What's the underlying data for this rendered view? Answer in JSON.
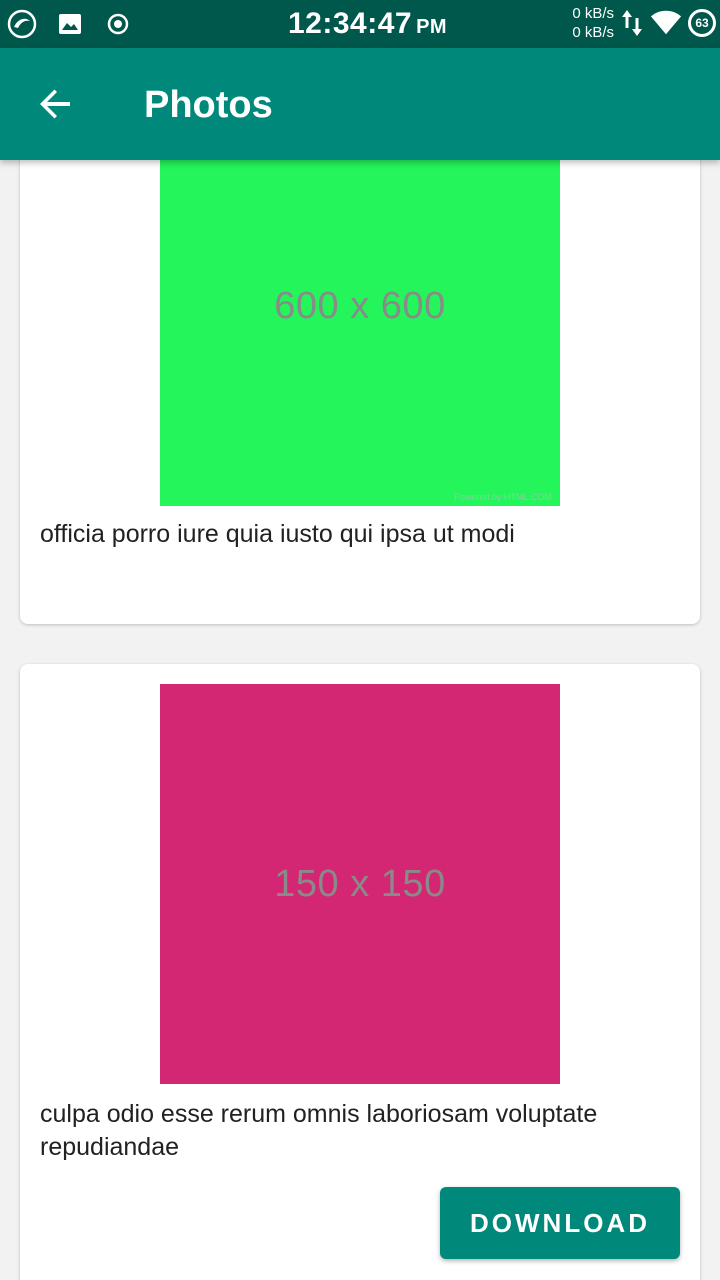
{
  "status_bar": {
    "time": "12:34:47",
    "ampm": "PM",
    "net_up": "0 kB/s",
    "net_down": "0 kB/s",
    "battery": "63",
    "icons": [
      "app-notification-icon",
      "image-icon",
      "record-icon",
      "data-transfer-icon",
      "wifi-icon",
      "battery-icon"
    ]
  },
  "app_bar": {
    "title": "Photos",
    "back_icon": "arrow-left-icon",
    "color": "#00897b"
  },
  "cards": [
    {
      "thumbnail_text": "600 x 600",
      "thumbnail_credit": "Powered by HTML.COM",
      "thumbnail_color": "#24f55b",
      "caption": "officia porro iure quia iusto qui ipsa ut modi"
    },
    {
      "thumbnail_text": "150 x 150",
      "thumbnail_color": "#d32774",
      "caption": "culpa odio esse rerum omnis laboriosam voluptate repudiandae",
      "button_label": "DOWNLOAD"
    }
  ],
  "colors": {
    "status_bar": "#00574b",
    "accent": "#00897b",
    "background": "#f2f2f2"
  }
}
